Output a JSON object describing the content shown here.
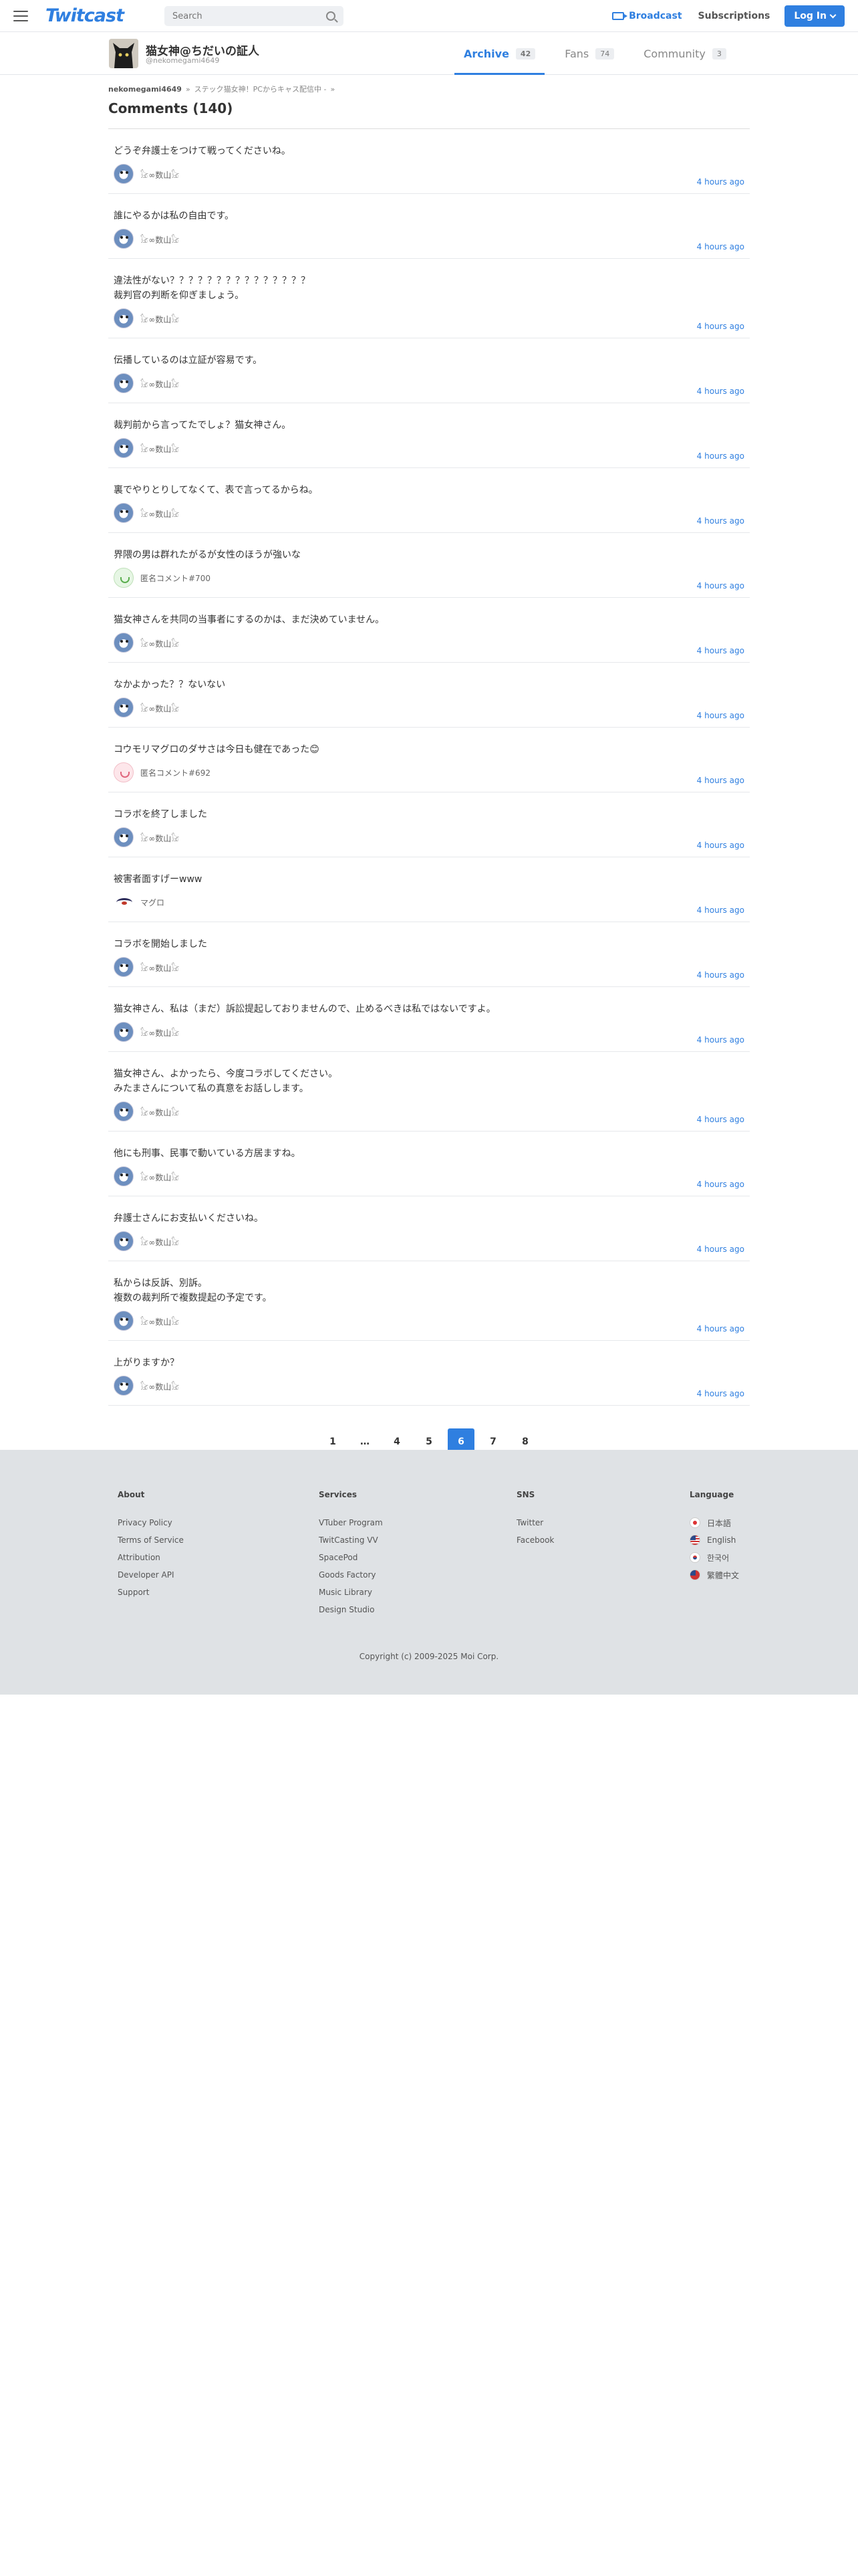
{
  "header": {
    "logo": "Twitcast",
    "search_placeholder": "Search",
    "broadcast_label": "Broadcast",
    "subscriptions_label": "Subscriptions",
    "login_label": "Log In"
  },
  "profile": {
    "name": "猫女神@ちだいの証人",
    "handle": "@nekomegami4649",
    "tabs": [
      {
        "label": "Archive",
        "count": "42"
      },
      {
        "label": "Fans",
        "count": "74"
      },
      {
        "label": "Community",
        "count": "3"
      }
    ]
  },
  "breadcrumb": {
    "user": "nekomegami4649",
    "sep": "»",
    "movie": "ステック猫女神！PCからキャス配信中 -",
    "more": "»"
  },
  "page_title": "Comments (140)",
  "comments": [
    {
      "text": "どうぞ弁護士をつけて戦ってくださいね。",
      "author": "𓃠∞数山𓃠",
      "avatar": "seal",
      "time": "4 hours ago"
    },
    {
      "text": "誰にやるかは私の自由です。",
      "author": "𓃠∞数山𓃠",
      "avatar": "seal",
      "time": "4 hours ago"
    },
    {
      "text": "違法性がない？？？？？？？？？？？？？？？\n裁判官の判断を仰ぎましょう。",
      "author": "𓃠∞数山𓃠",
      "avatar": "seal",
      "time": "4 hours ago"
    },
    {
      "text": "伝播しているのは立証が容易です。",
      "author": "𓃠∞数山𓃠",
      "avatar": "seal",
      "time": "4 hours ago"
    },
    {
      "text": "裁判前から言ってたでしょ？猫女神さん。",
      "author": "𓃠∞数山𓃠",
      "avatar": "seal",
      "time": "4 hours ago"
    },
    {
      "text": "裏でやりとりしてなくて、表で言ってるからね。",
      "author": "𓃠∞数山𓃠",
      "avatar": "seal",
      "time": "4 hours ago"
    },
    {
      "text": "界隈の男は群れたがるが女性のほうが強いな",
      "author": "匿名コメント#700",
      "avatar": "green",
      "time": "4 hours ago"
    },
    {
      "text": "猫女神さんを共同の当事者にするのかは、まだ決めていません。",
      "author": "𓃠∞数山𓃠",
      "avatar": "seal",
      "time": "4 hours ago"
    },
    {
      "text": "なかよかった？？ないない",
      "author": "𓃠∞数山𓃠",
      "avatar": "seal",
      "time": "4 hours ago"
    },
    {
      "text": "コウモリマグロのダサさは今日も健在であった😊",
      "author": "匿名コメント#692",
      "avatar": "pink",
      "time": "4 hours ago"
    },
    {
      "text": "コラボを終了しました",
      "author": "𓃠∞数山𓃠",
      "avatar": "seal",
      "time": "4 hours ago"
    },
    {
      "text": "被害者面すげーwww",
      "author": "マグロ",
      "avatar": "eye",
      "time": "4 hours ago"
    },
    {
      "text": "コラボを開始しました",
      "author": "𓃠∞数山𓃠",
      "avatar": "seal",
      "time": "4 hours ago"
    },
    {
      "text": "猫女神さん、私は（まだ）訴訟提起しておりませんので、止めるべきは私ではないですよ。",
      "author": "𓃠∞数山𓃠",
      "avatar": "seal",
      "time": "4 hours ago"
    },
    {
      "text": "猫女神さん、よかったら、今度コラボしてください。\nみたまさんについて私の真意をお話しします。",
      "author": "𓃠∞数山𓃠",
      "avatar": "seal",
      "time": "4 hours ago"
    },
    {
      "text": "他にも刑事、民事で動いている方居ますね。",
      "author": "𓃠∞数山𓃠",
      "avatar": "seal",
      "time": "4 hours ago"
    },
    {
      "text": "弁護士さんにお支払いくださいね。",
      "author": "𓃠∞数山𓃠",
      "avatar": "seal",
      "time": "4 hours ago"
    },
    {
      "text": "私からは反訴、別訴。\n複数の裁判所で複数提起の予定です。",
      "author": "𓃠∞数山𓃠",
      "avatar": "seal",
      "time": "4 hours ago"
    },
    {
      "text": "上がりますか？",
      "author": "𓃠∞数山𓃠",
      "avatar": "seal",
      "time": "4 hours ago"
    }
  ],
  "pagination": {
    "pages": [
      "1",
      "…",
      "4",
      "5",
      "6",
      "7",
      "8"
    ],
    "current": "6"
  },
  "footer": {
    "about": {
      "title": "About",
      "links": [
        "Privacy Policy",
        "Terms of Service",
        "Attribution",
        "Developer API",
        "Support"
      ]
    },
    "services": {
      "title": "Services",
      "links": [
        "VTuber Program",
        "TwitCasting VV",
        "SpacePod",
        "Goods Factory",
        "Music Library",
        "Design Studio"
      ]
    },
    "sns": {
      "title": "SNS",
      "links": [
        "Twitter",
        "Facebook"
      ]
    },
    "language": {
      "title": "Language",
      "links": [
        {
          "label": "日本語",
          "flag": "flag-jp"
        },
        {
          "label": "English",
          "flag": "flag-us"
        },
        {
          "label": "한국어",
          "flag": "flag-kr"
        },
        {
          "label": "繁體中文",
          "flag": "flag-tw"
        }
      ]
    },
    "copyright": "Copyright (c) 2009-2025 Moi Corp."
  },
  "colors": {
    "accent": "#2f7fe0",
    "footer_bg": "#dfe2e5"
  }
}
